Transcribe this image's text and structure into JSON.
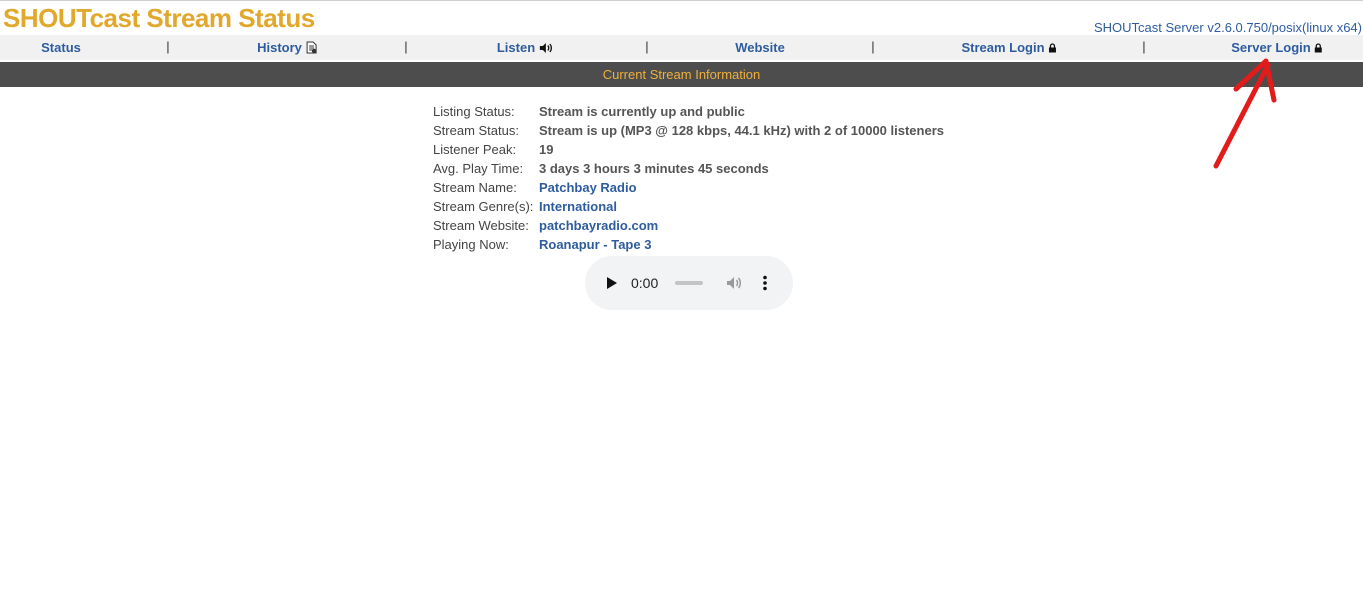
{
  "header": {
    "title": "SHOUTcast Stream Status",
    "server_version": "SHOUTcast Server v2.6.0.750/posix(linux x64)"
  },
  "nav": {
    "items": [
      {
        "label": "Status",
        "icon": ""
      },
      {
        "label": "History",
        "icon": "history-document-icon"
      },
      {
        "label": "Listen",
        "icon": "speaker-icon"
      },
      {
        "label": "Website",
        "icon": ""
      },
      {
        "label": "Stream Login",
        "icon": "lock-icon"
      },
      {
        "label": "Server Login",
        "icon": "lock-icon"
      }
    ],
    "separator": "|"
  },
  "section_title": "Current Stream Information",
  "stream_info": [
    {
      "label": "Listing Status:",
      "value": "Stream is currently up and public"
    },
    {
      "label": "Stream Status:",
      "value": "Stream is up (MP3 @ 128 kbps, 44.1 kHz) with 2 of 10000 listeners"
    },
    {
      "label": "Listener Peak:",
      "value": "19"
    },
    {
      "label": "Avg. Play Time:",
      "value": "3 days 3 hours 3 minutes 45 seconds"
    },
    {
      "label": "Stream Name:",
      "value": "Patchbay Radio"
    },
    {
      "label": "Stream Genre(s):",
      "value": "International"
    },
    {
      "label": "Stream Website:",
      "value": "patchbayradio.com"
    },
    {
      "label": "Playing Now:",
      "value": "Roanapur - Tape 3"
    }
  ],
  "player": {
    "time": "0:00",
    "progress": 0
  },
  "colors": {
    "brand": "#e1a82c",
    "link": "#2e5c9f",
    "section_bar": "#4d4d4d",
    "annotation": "#e21b1b"
  }
}
